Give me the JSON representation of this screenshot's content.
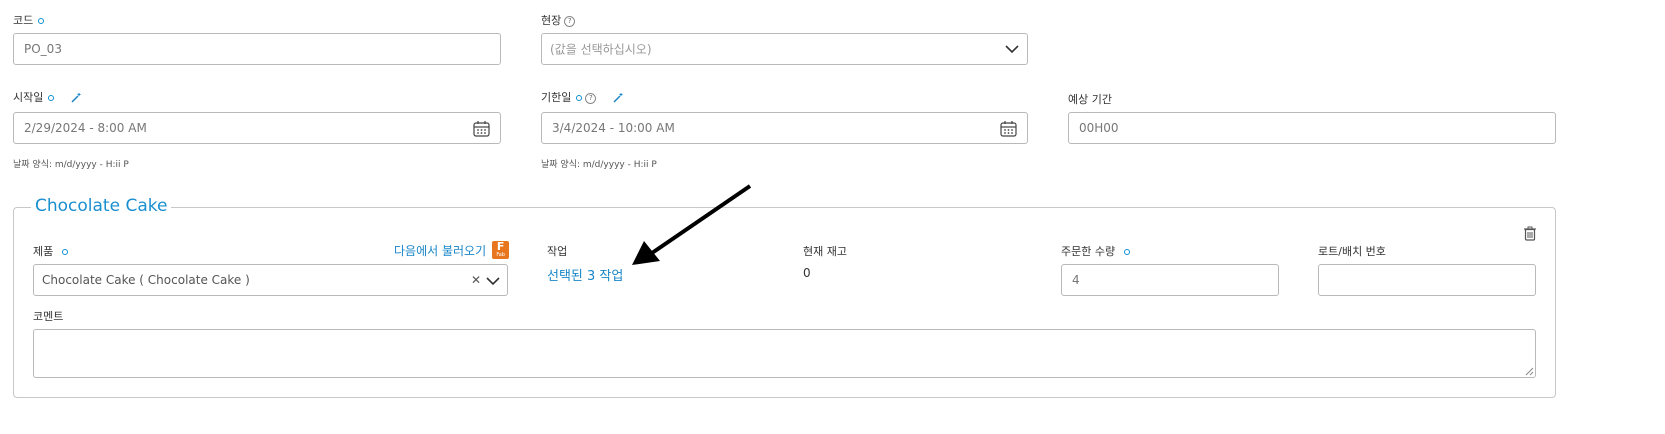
{
  "form": {
    "code": {
      "label": "코드",
      "value": "PO_03"
    },
    "site": {
      "label": "현장",
      "placeholder": "(값을 선택하십시오)"
    },
    "start_date": {
      "label": "시작일",
      "value": "2/29/2024 - 8:00 AM",
      "hint": "날짜 양식: m/d/yyyy - H:ii P"
    },
    "due_date": {
      "label": "기한일",
      "value": "3/4/2024 - 10:00 AM",
      "hint": "날짜 양식: m/d/yyyy - H:ii P"
    },
    "expected_duration": {
      "label": "예상 기간",
      "value": "00H00"
    }
  },
  "product_section": {
    "title": "Chocolate Cake",
    "product": {
      "label": "제품",
      "value": "Chocolate Cake ( Chocolate Cake )",
      "load_from_label": "다음에서 불러오기",
      "load_from_icon_letter": "F",
      "load_from_icon_sub": "Fab"
    },
    "operations": {
      "label": "작업",
      "value": "선택된 3 작업"
    },
    "current_stock": {
      "label": "현재 재고",
      "value": "0"
    },
    "ordered_qty": {
      "label": "주문한 수량",
      "value": "4"
    },
    "lot_batch": {
      "label": "로트/배치 번호",
      "value": ""
    },
    "comment": {
      "label": "코멘트",
      "value": ""
    }
  },
  "colors": {
    "accent": "#1a86c8",
    "required_dot": "#0d8fd0",
    "border": "#b9b9b9",
    "fab_orange": "#e8761e"
  },
  "icons": [
    "calendar-icon",
    "chevron-down-icon",
    "clear-icon",
    "help-icon",
    "magic-wand-icon",
    "trash-icon",
    "annotation-arrow"
  ]
}
